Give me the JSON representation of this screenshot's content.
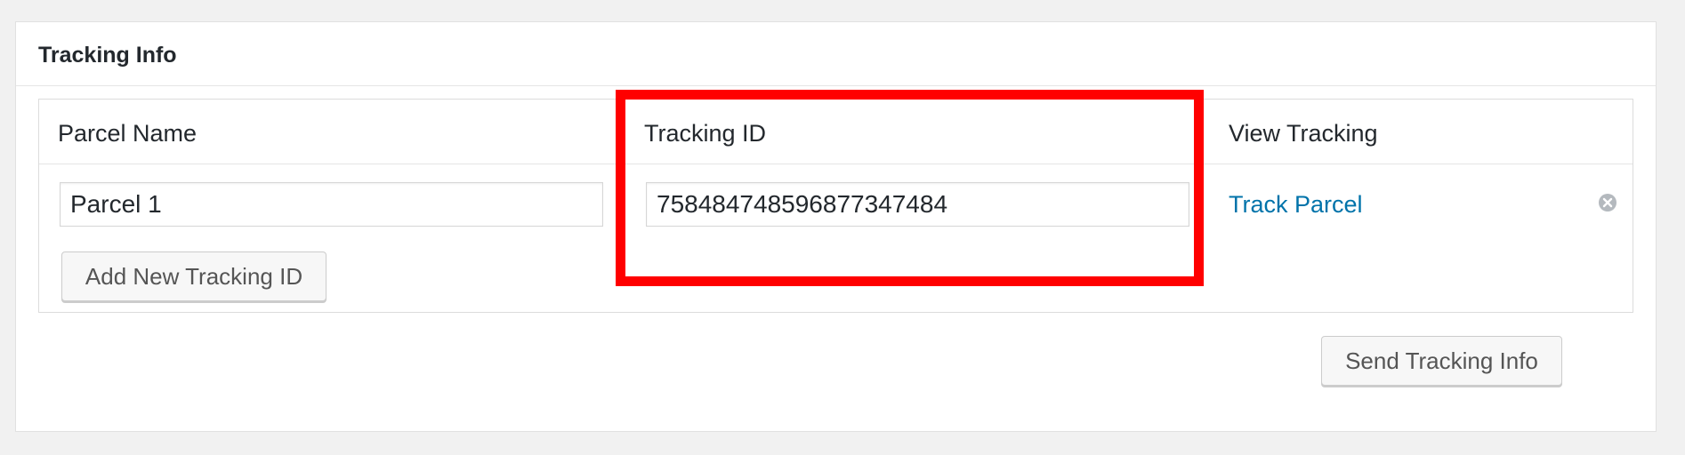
{
  "panel": {
    "title": "Tracking Info"
  },
  "table": {
    "columns": {
      "parcel_name": "Parcel Name",
      "tracking_id": "Tracking ID",
      "view_tracking": "View Tracking"
    },
    "rows": [
      {
        "parcel_name_value": "Parcel 1",
        "tracking_id_value": "75848474859687734748 4",
        "view_link_label": "Track Parcel",
        "remove_icon": "close-circle-icon"
      }
    ]
  },
  "buttons": {
    "add_new_tracking_id": "Add New Tracking ID",
    "send_tracking_info": "Send Tracking Info"
  },
  "colors": {
    "link": "#0073aa",
    "highlight": "#ff0000",
    "page_bg": "#f1f1f1"
  }
}
